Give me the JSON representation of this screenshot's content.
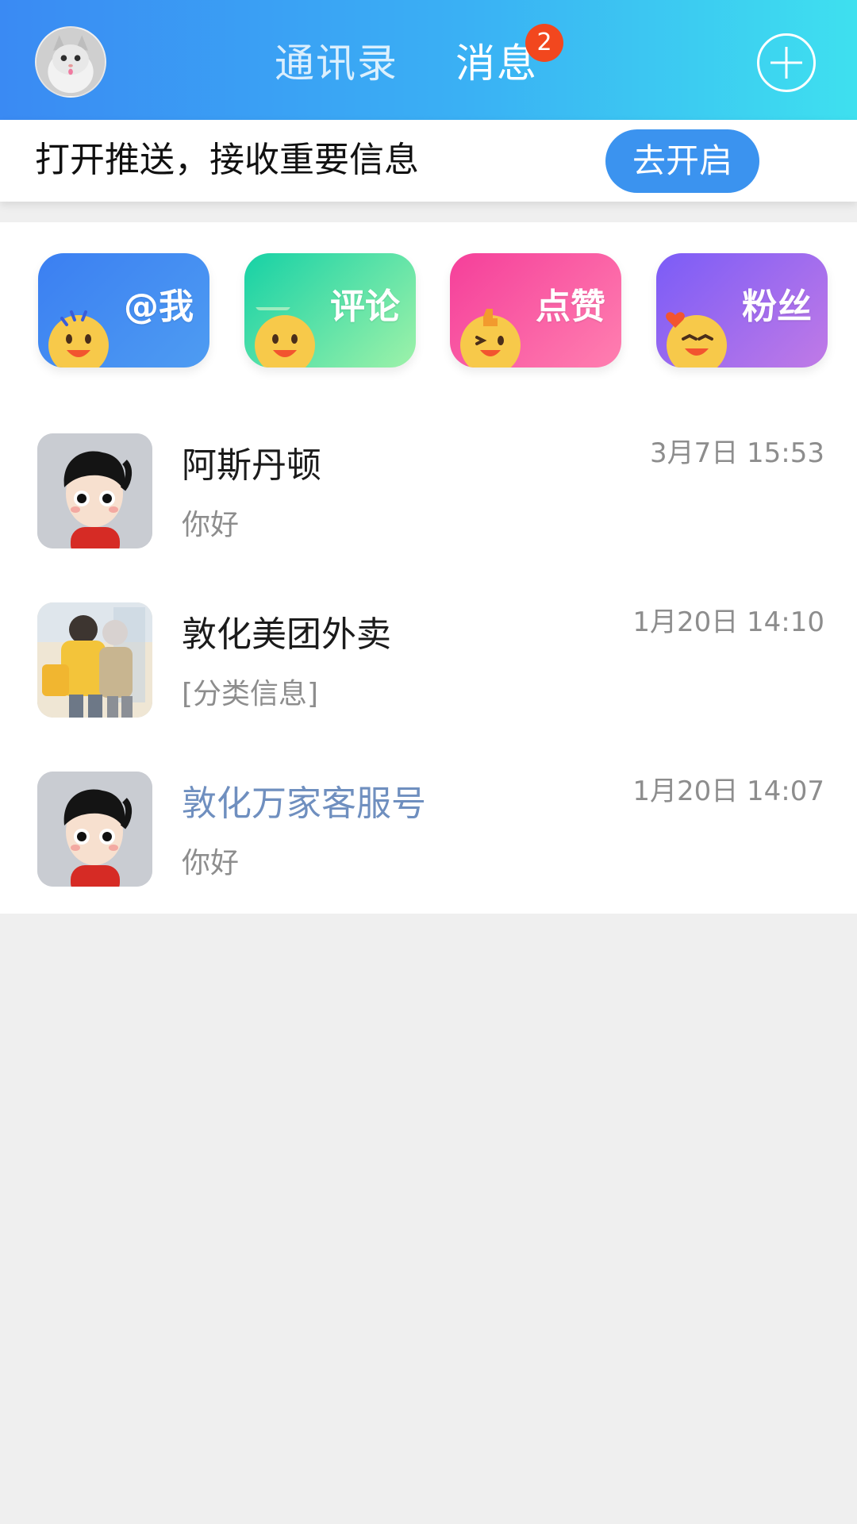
{
  "header": {
    "tabs": [
      {
        "label": "通讯录",
        "active": false
      },
      {
        "label": "消息",
        "active": true
      }
    ],
    "unread_badge": "2",
    "gradient": [
      "#3a8af3",
      "#3ee0ef"
    ],
    "icons": {
      "avatar": "user-avatar-cat",
      "add": "plus-circle-icon"
    }
  },
  "push_banner": {
    "text": "打开推送，接收重要信息",
    "button": "去开启",
    "button_color": "#3b93ef",
    "close_icon": "close-icon"
  },
  "quick_actions": [
    {
      "label": "@我",
      "icon": "mention-emoji-icon",
      "color": "#3b7ff2"
    },
    {
      "label": "评论",
      "icon": "comment-emoji-icon",
      "color": "#16d1a6"
    },
    {
      "label": "点赞",
      "icon": "like-emoji-icon",
      "color": "#f53f9a"
    },
    {
      "label": "粉丝",
      "icon": "fans-emoji-icon",
      "color": "#7b5cf7"
    }
  ],
  "conversations": [
    {
      "name": "阿斯丹顿",
      "preview": "你好",
      "time": "3月7日 15:53",
      "avatar": "cartoon-boy-avatar"
    },
    {
      "name": "敦化美团外卖",
      "preview": "[分类信息]",
      "time": "1月20日 14:10",
      "avatar": "delivery-riders-avatar"
    },
    {
      "name": "敦化万家客服号",
      "preview": "你好",
      "time": "1月20日 14:07",
      "avatar": "cartoon-boy-avatar",
      "name_color": "#6f8fbf"
    }
  ]
}
